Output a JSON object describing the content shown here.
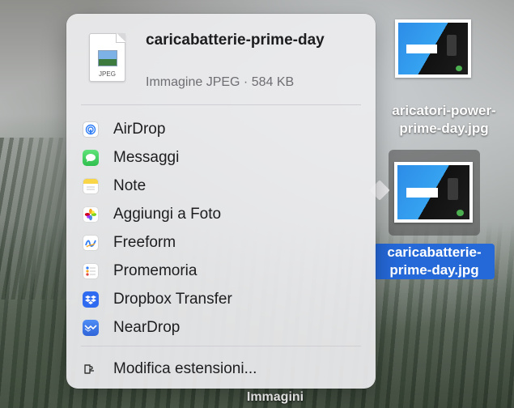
{
  "share_popover": {
    "file": {
      "name": "caricabatterie-prime-day",
      "icon_ext": "JPEG",
      "meta": "Immagine JPEG · 584 KB"
    },
    "items": [
      {
        "label": "AirDrop",
        "icon": "airdrop-icon"
      },
      {
        "label": "Messaggi",
        "icon": "messages-icon"
      },
      {
        "label": "Note",
        "icon": "notes-icon"
      },
      {
        "label": "Aggiungi a Foto",
        "icon": "photos-icon"
      },
      {
        "label": "Freeform",
        "icon": "freeform-icon"
      },
      {
        "label": "Promemoria",
        "icon": "reminders-icon"
      },
      {
        "label": "Dropbox Transfer",
        "icon": "dropbox-icon"
      },
      {
        "label": "NearDrop",
        "icon": "neardrop-icon"
      }
    ],
    "edit_extensions": {
      "label": "Modifica estensioni...",
      "icon": "extensions-icon"
    }
  },
  "desktop": {
    "files": [
      {
        "name_line1": "aricatori-power-",
        "name_line2": "prime-day.jpg",
        "selected": false
      },
      {
        "name_line1": "caricabatterie-",
        "name_line2": "prime-day.jpg",
        "selected": true
      }
    ],
    "folder": {
      "name": "Immagini"
    }
  },
  "colors": {
    "selection": "#2568d8",
    "popover_bg": "#ececee"
  }
}
